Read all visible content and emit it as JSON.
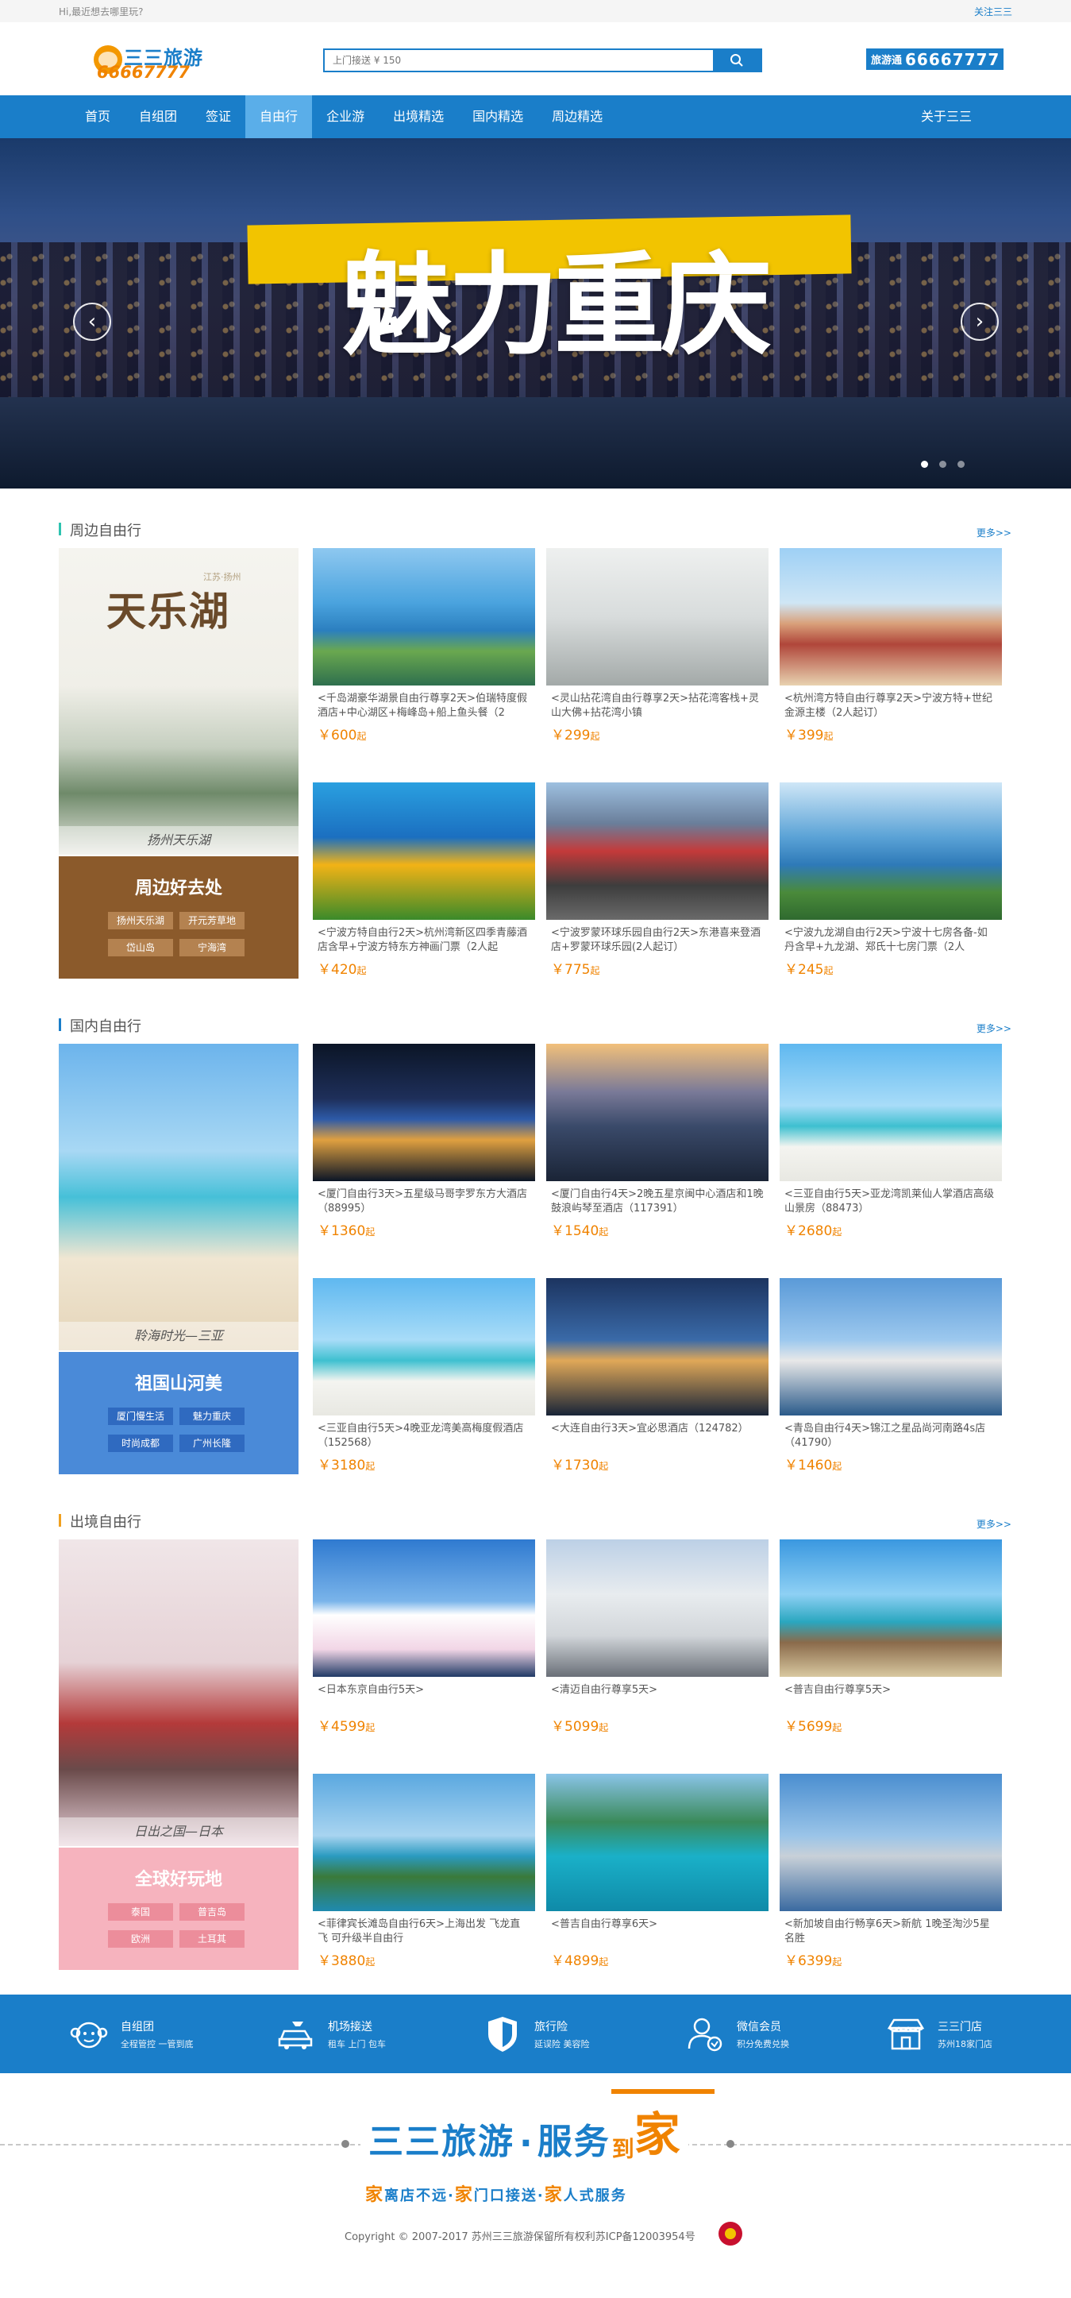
{
  "topbar": {
    "greeting": "Hi,最近想去哪里玩?",
    "follow": "关注三三"
  },
  "header": {
    "logo_name": "三三旅游",
    "logo_tel": "66667777",
    "search_placeholder": "上门接送 ¥ 150",
    "hotline_label": "旅游通",
    "hotline_number": "66667777"
  },
  "nav": {
    "items": [
      "首页",
      "自组团",
      "签证",
      "自由行",
      "企业游",
      "出境精选",
      "国内精选",
      "周边精选"
    ],
    "active": "自由行",
    "about": "关于三三"
  },
  "banner": {
    "title": "魅力重庆"
  },
  "sections": [
    {
      "title": "周边自由行",
      "more": "更多>>",
      "accent": "#2ec3b0",
      "feature": {
        "caption": "扬州天乐湖",
        "img_title": "天乐湖",
        "img_sub": "江苏·扬州",
        "box_title": "周边好去处",
        "box_color": "#8b5a2b",
        "tag_color": "#b48250",
        "tags": [
          "扬州天乐湖",
          "开元芳草地",
          "岱山岛",
          "宁海湾"
        ]
      },
      "cards": [
        {
          "desc": "<千岛湖豪华湖景自由行尊享2天>伯瑞特度假酒店+中心湖区+梅峰岛+船上鱼头餐（2",
          "price": "￥600",
          "unit": "起",
          "img": "ph-sea"
        },
        {
          "desc": "<灵山拈花湾自由行尊享2天>拈花湾客栈+灵山大佛+拈花湾小镇",
          "price": "￥299",
          "unit": "起",
          "img": "ph-buddha"
        },
        {
          "desc": "<杭州湾方特自由行尊享2天>宁波方特+世纪金源主楼（2人起订）",
          "price": "￥399",
          "unit": "起",
          "img": "ph-castle"
        },
        {
          "desc": "<宁波方特自由行2天>杭州湾新区四季青藤酒店含早+宁波方特东方神画门票（2人起",
          "price": "￥420",
          "unit": "起",
          "img": "ph-cartoon"
        },
        {
          "desc": "<宁波罗蒙环球乐园自由行2天>东港喜来登酒店+罗蒙环球乐园(2人起订）",
          "price": "￥775",
          "unit": "起",
          "img": "ph-park"
        },
        {
          "desc": "<宁波九龙湖自由行2天>宁波十七房各备-如丹含早+九龙湖、郑氏十七房门票（2人",
          "price": "￥245",
          "unit": "起",
          "img": "ph-lake"
        }
      ]
    },
    {
      "title": "国内自由行",
      "more": "更多>>",
      "accent": "#1a7ec9",
      "feature": {
        "caption": "聆海时光—三亚",
        "img_title": "",
        "img_sub": "",
        "box_title": "祖国山河美",
        "box_color": "#4a8ad8",
        "tag_color": "#2f6ac0",
        "tags": [
          "厦门慢生活",
          "魅力重庆",
          "时尚成都",
          "广州长隆"
        ]
      },
      "cards": [
        {
          "desc": "<厦门自由行3天>五星级马哥孛罗东方大酒店（88995）",
          "price": "￥1360",
          "unit": "起",
          "img": "ph-night"
        },
        {
          "desc": "<厦门自由行4天>2晚五星京闽中心酒店和1晚鼓浪屿琴至酒店（117391）",
          "price": "￥1540",
          "unit": "起",
          "img": "ph-dusk"
        },
        {
          "desc": "<三亚自由行5天>亚龙湾凯莱仙人掌酒店高级山景房（88473）",
          "price": "￥2680",
          "unit": "起",
          "img": "ph-beach"
        },
        {
          "desc": "<三亚自由行5天>4晚亚龙湾美高梅度假酒店（152568）",
          "price": "￥3180",
          "unit": "起",
          "img": "ph-beach"
        },
        {
          "desc": "<大连自由行3天>宜必思酒店（124782）",
          "price": "￥1730",
          "unit": "起",
          "img": "ph-bridge"
        },
        {
          "desc": "<青岛自由行4天>锦江之星品尚河南路4s店（41790）",
          "price": "￥1460",
          "unit": "起",
          "img": "ph-sail"
        }
      ]
    },
    {
      "title": "出境自由行",
      "more": "更多>>",
      "accent": "#f0a020",
      "feature": {
        "caption": "日出之国—日本",
        "img_title": "",
        "img_sub": "",
        "box_title": "全球好玩地",
        "box_color": "#f6b3be",
        "tag_color": "#ec8d9b",
        "tags": [
          "泰国",
          "普吉岛",
          "欧洲",
          "土耳其"
        ]
      },
      "cards": [
        {
          "desc": "<日本东京自由行5天>",
          "price": "￥4599",
          "unit": "起",
          "img": "ph-fuji"
        },
        {
          "desc": "<清迈自由行尊享5天>",
          "price": "￥5099",
          "unit": "起",
          "img": "ph-temple"
        },
        {
          "desc": "<普吉自由行尊享5天>",
          "price": "￥5699",
          "unit": "起",
          "img": "ph-rocks"
        },
        {
          "desc": "<菲律宾长滩岛自由行6天>上海出发 飞龙直飞 可升级半自由行",
          "price": "￥3880",
          "unit": "起",
          "img": "ph-island"
        },
        {
          "desc": "<普吉自由行尊享6天>",
          "price": "￥4899",
          "unit": "起",
          "img": "ph-boat"
        },
        {
          "desc": "<新加坡自由行畅享6天>新航 1晚圣淘沙5星名胜",
          "price": "￥6399",
          "unit": "起",
          "img": "ph-merlion"
        }
      ]
    }
  ],
  "services": [
    {
      "title": "自组团",
      "sub": "全程管控 一管到底",
      "icon": "monkey-face-icon"
    },
    {
      "title": "机场接送",
      "sub": "租车 上门 包车",
      "icon": "car-icon"
    },
    {
      "title": "旅行险",
      "sub": "延误险 美容险",
      "icon": "shield-icon"
    },
    {
      "title": "微信会员",
      "sub": "积分免费兑换",
      "icon": "member-icon"
    },
    {
      "title": "三三门店",
      "sub": "苏州18家门店",
      "icon": "store-icon"
    }
  ],
  "footer": {
    "slogan_brand": "三三旅游",
    "slogan_dot": "·",
    "slogan_service": "服务",
    "slogan_dao": "到",
    "slogan_home": "家",
    "sub_parts": [
      "家",
      "离店不远·",
      "家",
      "门口接送·",
      "家",
      "人式服务"
    ],
    "copyright": "Copyright © 2007-2017 苏州三三旅游保留所有权利苏ICP备12003954号"
  },
  "colors": {
    "primary": "#1a7ec9",
    "accent": "#f08300"
  }
}
